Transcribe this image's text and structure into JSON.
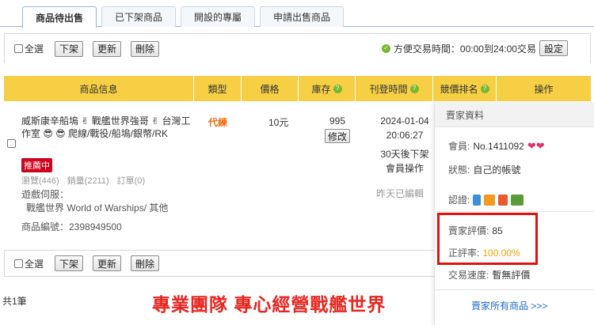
{
  "tabs": [
    "商品待出售",
    "已下架商品",
    "開設的專屬",
    "申請出售商品"
  ],
  "toolbar": {
    "select_all": "全選",
    "delist": "下架",
    "update": "更新",
    "delete": "刪除",
    "trade_time": "方便交易時間：00:00到24:00交易",
    "set": "設定"
  },
  "table": {
    "headers": [
      "商品信息",
      "類型",
      "價格",
      "庫存",
      "刊登時間",
      "競價排名",
      "操作"
    ]
  },
  "item": {
    "title": "威斯康辛船塢 ✌ 戰艦世界強哥 ✌ 台灣工作室 😎 😎 爬線/戰役/船塢/銀幣/RK",
    "badge": "推薦中",
    "views": "瀏覽(446)",
    "sales": "銷量(2211)",
    "orders": "訂單(0)",
    "server_label": "遊戲伺服：",
    "server_value": "戰艦世界 World of Warships/ 其他",
    "item_no": "商品編號：2398949500",
    "type": "代練",
    "price": "10元",
    "stock": "995",
    "edit_btn": "修改",
    "post_date": "2024-01-04",
    "post_time": "20:06:27",
    "expire": "30天後下架",
    "member_op": "會員操作",
    "edited": "昨天已編輯"
  },
  "footer": {
    "total": "共1筆",
    "slogan": "專業團隊 專心經營戰艦世界"
  },
  "seller": {
    "heading": "賣家資料",
    "member_label": "會員:",
    "member_value": "No.1411092",
    "status_label": "狀態:",
    "status_value": "自己的帳號",
    "verify_label": "認證:",
    "rating_label": "賣家評價:",
    "rating_value": "85",
    "positive_label": "正評率:",
    "positive_value": "100.00%",
    "speed_label": "交易速度:",
    "speed_value": "暫無評價",
    "all_items": "賣家所有商品 >>>"
  },
  "colors": {
    "header_bg": "#f7cf45",
    "accent_red": "#e1120f",
    "type_orange": "#f06a0e",
    "link_blue": "#1e6bc8"
  }
}
